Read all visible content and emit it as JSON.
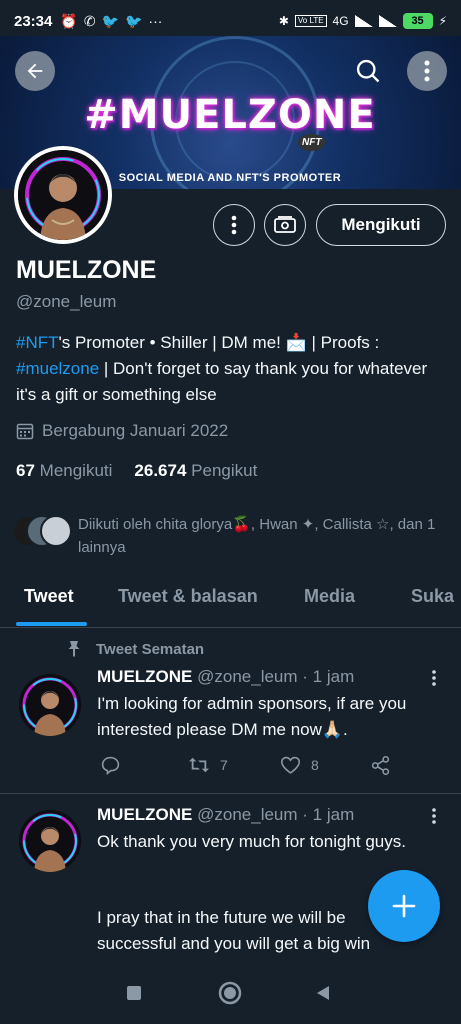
{
  "status_bar": {
    "time": "23:34",
    "battery": "35",
    "volte": "Vo LTE",
    "network": "4G"
  },
  "banner": {
    "title": "#MUELZONE",
    "subtitle": "SOCIAL MEDIA AND NFT'S PROMOTER",
    "badge": "NFT"
  },
  "profile": {
    "name": "MUELZONE",
    "handle": "@zone_leum",
    "bio": {
      "part1_link": "#NFT",
      "part2": "'s Promoter • Shiller  |   DM me! 📩    |",
      "part3": "Proofs : ",
      "part4_link": "#muelzone",
      "part5": " | Don't forget to say thank you for whatever it's a gift or something else"
    },
    "joined": "Bergabung Januari 2022",
    "following_count": "67",
    "following_label": "Mengikuti",
    "followers_count": "26.674",
    "followers_label": "Pengikut",
    "followed_by": "Diikuti oleh chita glorya🍒, Hwan ✦, Callista ☆, dan 1 lainnya",
    "follow_button": "Mengikuti"
  },
  "tabs": [
    "Tweet",
    "Tweet & balasan",
    "Media",
    "Suka"
  ],
  "pinned_label": "Tweet Sematan",
  "tweets": [
    {
      "name": "MUELZONE",
      "meta": "@zone_leum · 1 jam",
      "text": "I'm looking for admin sponsors, if  are you interested  please DM me now🙏🏻.",
      "retweets": "7",
      "likes": "8"
    },
    {
      "name": "MUELZONE",
      "meta": "@zone_leum · 1 jam",
      "text_line1": "Ok thank you very much for tonight guys.",
      "text_line2": "I pray that in the future we will be successful and you will get a big win"
    }
  ],
  "colors": {
    "background": "#15202b",
    "accent": "#1d9bf0",
    "muted": "#8b98a5",
    "border": "#38444d"
  }
}
